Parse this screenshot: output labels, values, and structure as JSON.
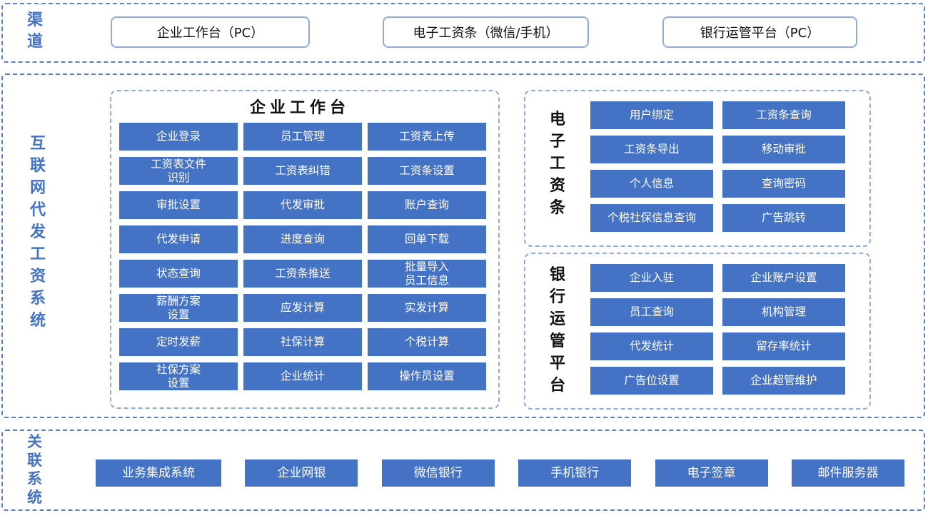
{
  "channels": {
    "label": [
      "渠",
      "道"
    ],
    "items": [
      "企业工作台（PC）",
      "电子工资条（微信/手机）",
      "银行运管平台（PC）"
    ]
  },
  "core": {
    "label": [
      "互",
      "联",
      "网",
      "代",
      "发",
      "工",
      "资",
      "系",
      "统"
    ],
    "workbench": {
      "title": "企业工作台",
      "items": [
        "企业登录",
        "员工管理",
        "工资表上传",
        "工资表文件\n识别",
        "工资表纠错",
        "工资条设置",
        "审批设置",
        "代发审批",
        "账户查询",
        "代发申请",
        "进度查询",
        "回单下载",
        "状态查询",
        "工资条推送",
        "批量导入\n员工信息",
        "薪酬方案\n设置",
        "应发计算",
        "实发计算",
        "定时发薪",
        "社保计算",
        "个税计算",
        "社保方案\n设置",
        "企业统计",
        "操作员设置"
      ]
    },
    "payslip": {
      "title": [
        "电",
        "子",
        "工",
        "资",
        "条"
      ],
      "items": [
        "用户绑定",
        "工资条查询",
        "工资条导出",
        "移动审批",
        "个人信息",
        "查询密码",
        "个税社保信息查询",
        "广告跳转"
      ]
    },
    "bank": {
      "title": [
        "银",
        "行",
        "运",
        "管",
        "平",
        "台"
      ],
      "items": [
        "企业入驻",
        "企业账户设置",
        "员工查询",
        "机构管理",
        "代发统计",
        "留存率统计",
        "广告位设置",
        "企业超管维护"
      ]
    }
  },
  "related": {
    "label": [
      "关",
      "联",
      "系",
      "统"
    ],
    "items": [
      "业务集成系统",
      "企业网银",
      "微信银行",
      "手机银行",
      "电子签章",
      "邮件服务器"
    ]
  },
  "colors": {
    "accent": "#4472c4",
    "dashed_border": "#5b7fc7",
    "channel_border": "#8faadc"
  }
}
